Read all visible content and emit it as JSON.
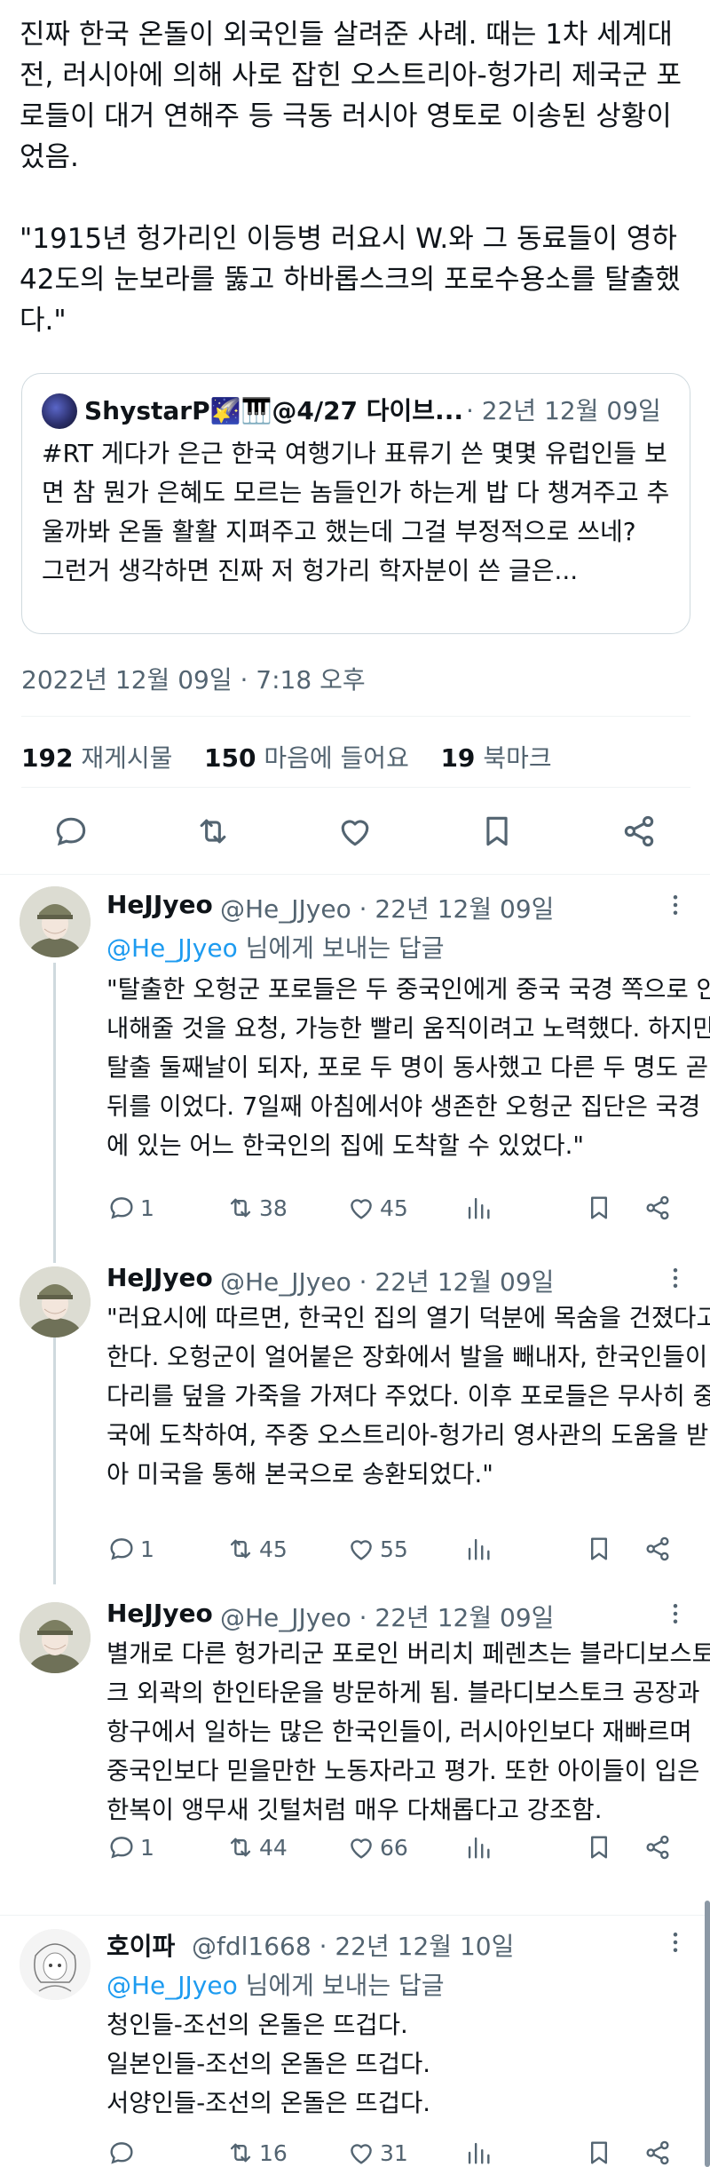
{
  "main_tweet": {
    "text": "진짜 한국 온돌이 외국인들 살려준 사례. 때는 1차 세계대전, 러시아에 의해 사로 잡힌 오스트리아-헝가리 제국군 포로들이 대거 연해주 등 극동 러시아 영토로 이송된 상황이었음.\n\n\"1915년 헝가리인 이등병 러요시 W.와 그 동료들이 영하 42도의 눈보라를 뚫고 하바롭스크의 포로수용소를 탈출했다.\"",
    "quote": {
      "name": "ShystarP🌠🎹@4/27 다이브...",
      "meta": "· 22년 12월 09일",
      "text": "#RT 게다가 은근 한국 여행기나 표류기 쓴 몇몇 유럽인들 보면 참 뭔가 은혜도 모르는 놈들인가 하는게 밥 다 챙겨주고 추울까봐 온돌 활활 지펴주고 했는데 그걸 부정적으로 쓰네?\n그런거 생각하면 진짜 저 헝가리 학자분이 쓴 글은..."
    },
    "timestamp": "2022년 12월 09일 · 7:18 오후",
    "stats": {
      "retweets": "192",
      "retweets_label": " 재게시물",
      "likes": "150",
      "likes_label": " 마음에 들어요",
      "bookmarks": "19",
      "bookmarks_label": " 북마크"
    }
  },
  "replies": [
    {
      "name": "HeJJyeo",
      "meta": "@He_JJyeo · 22년 12월 09일",
      "reply_to_handle": "@He_JJyeo",
      "reply_to_suffix": " 님에게 보내는 답글",
      "text": "\"탈출한 오헝군 포로들은 두 중국인에게 중국 국경 쪽으로 안내해줄 것을 요청, 가능한 빨리 움직이려고 노력했다. 하지만 탈출 둘째날이 되자, 포로 두 명이 동사했고 다른 두 명도 곧 뒤를 이었다. 7일째 아침에서야 생존한 오헝군 집단은 국경에 있는 어느 한국인의 집에 도착할 수 있었다.\"",
      "replies": "1",
      "retweets": "38",
      "likes": "45"
    },
    {
      "name": "HeJJyeo",
      "meta": "@He_JJyeo · 22년 12월 09일",
      "text": "\"러요시에 따르면, 한국인 집의 열기 덕분에 목숨을 건졌다고 한다. 오헝군이 얼어붙은 장화에서 발을 빼내자, 한국인들이 다리를 덮을 가죽을 가져다 주었다. 이후 포로들은 무사히 중국에 도착하여, 주중 오스트리아-헝가리 영사관의 도움을 받아 미국을 통해 본국으로 송환되었다.\"",
      "replies": "1",
      "retweets": "45",
      "likes": "55"
    },
    {
      "name": "HeJJyeo",
      "meta": "@He_JJyeo · 22년 12월 09일",
      "text": "별개로 다른 헝가리군 포로인 버리치 페렌츠는 블라디보스토크 외곽의 한인타운을 방문하게 됨. 블라디보스토크 공장과 항구에서 일하는 많은 한국인들이, 러시아인보다 재빠르며 중국인보다 믿을만한 노동자라고 평가. 또한 아이들이 입은 한복이 앵무새 깃털처럼 매우 다채롭다고 강조함.",
      "replies": "1",
      "retweets": "44",
      "likes": "66"
    },
    {
      "name": "호이파",
      "meta": "@fdl1668 · 22년 12월 10일",
      "reply_to_handle": "@He_JJyeo",
      "reply_to_suffix": " 님에게 보내는 답글",
      "text": "청인들-조선의 온돌은 뜨겁다.\n일본인들-조선의 온돌은 뜨겁다.\n서양인들-조선의 온돌은 뜨겁다.",
      "replies": "",
      "retweets": "16",
      "likes": "31"
    }
  ],
  "colors": {
    "accent": "#1d9bf0",
    "text": "#0f1419",
    "muted": "#536471",
    "border": "#cfd9de"
  }
}
